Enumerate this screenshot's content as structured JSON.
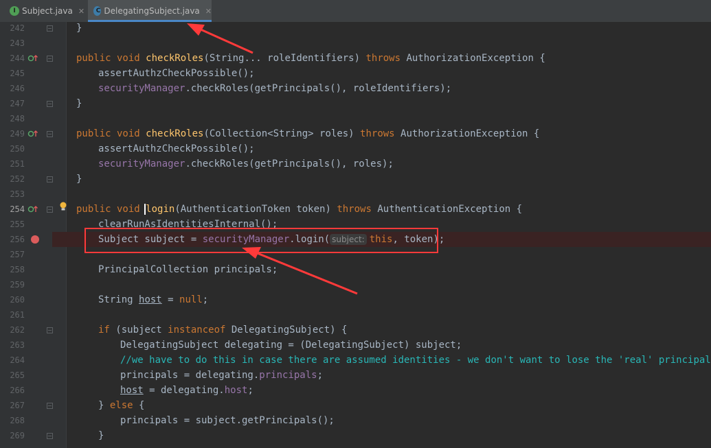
{
  "tabs": [
    {
      "label": "Subject.java",
      "icon": "interface-file-icon",
      "active": false,
      "close": "✕"
    },
    {
      "label": "DelegatingSubject.java",
      "icon": "class-file-icon",
      "active": true,
      "close": "✕"
    }
  ],
  "inlay_hint": "subject:",
  "lines": [
    {
      "num": "242",
      "text": "}"
    },
    {
      "num": "243",
      "text": ""
    },
    {
      "num": "244",
      "text": "public void checkRoles(String... roleIdentifiers) throws AuthorizationException {"
    },
    {
      "num": "245",
      "text": "assertAuthzCheckPossible();"
    },
    {
      "num": "246",
      "text": "securityManager.checkRoles(getPrincipals(), roleIdentifiers);"
    },
    {
      "num": "247",
      "text": "}"
    },
    {
      "num": "248",
      "text": ""
    },
    {
      "num": "249",
      "text": "public void checkRoles(Collection<String> roles) throws AuthorizationException {"
    },
    {
      "num": "250",
      "text": "assertAuthzCheckPossible();"
    },
    {
      "num": "251",
      "text": "securityManager.checkRoles(getPrincipals(), roles);"
    },
    {
      "num": "252",
      "text": "}"
    },
    {
      "num": "253",
      "text": ""
    },
    {
      "num": "254",
      "text": "public void login(AuthenticationToken token) throws AuthenticationException {"
    },
    {
      "num": "255",
      "text": "clearRunAsIdentitiesInternal();"
    },
    {
      "num": "256",
      "text": "Subject subject = securityManager.login(this, token);"
    },
    {
      "num": "257",
      "text": ""
    },
    {
      "num": "258",
      "text": "PrincipalCollection principals;"
    },
    {
      "num": "259",
      "text": ""
    },
    {
      "num": "260",
      "text": "String host = null;"
    },
    {
      "num": "261",
      "text": ""
    },
    {
      "num": "262",
      "text": "if (subject instanceof DelegatingSubject) {"
    },
    {
      "num": "263",
      "text": "DelegatingSubject delegating = (DelegatingSubject) subject;"
    },
    {
      "num": "264",
      "text": "//we have to do this in case there are assumed identities - we don't want to lose the 'real' principals:"
    },
    {
      "num": "265",
      "text": "principals = delegating.principals;"
    },
    {
      "num": "266",
      "text": "host = delegating.host;"
    },
    {
      "num": "267",
      "text": "} else {"
    },
    {
      "num": "268",
      "text": "principals = subject.getPrincipals();"
    },
    {
      "num": "269",
      "text": "}"
    }
  ],
  "colors": {
    "keyword": "#cc7832",
    "method": "#ffc66d",
    "field": "#9876aa",
    "comment": "#29b7b7",
    "annotation": "#ff3a3a",
    "breakpoint": "#db5c5c"
  }
}
